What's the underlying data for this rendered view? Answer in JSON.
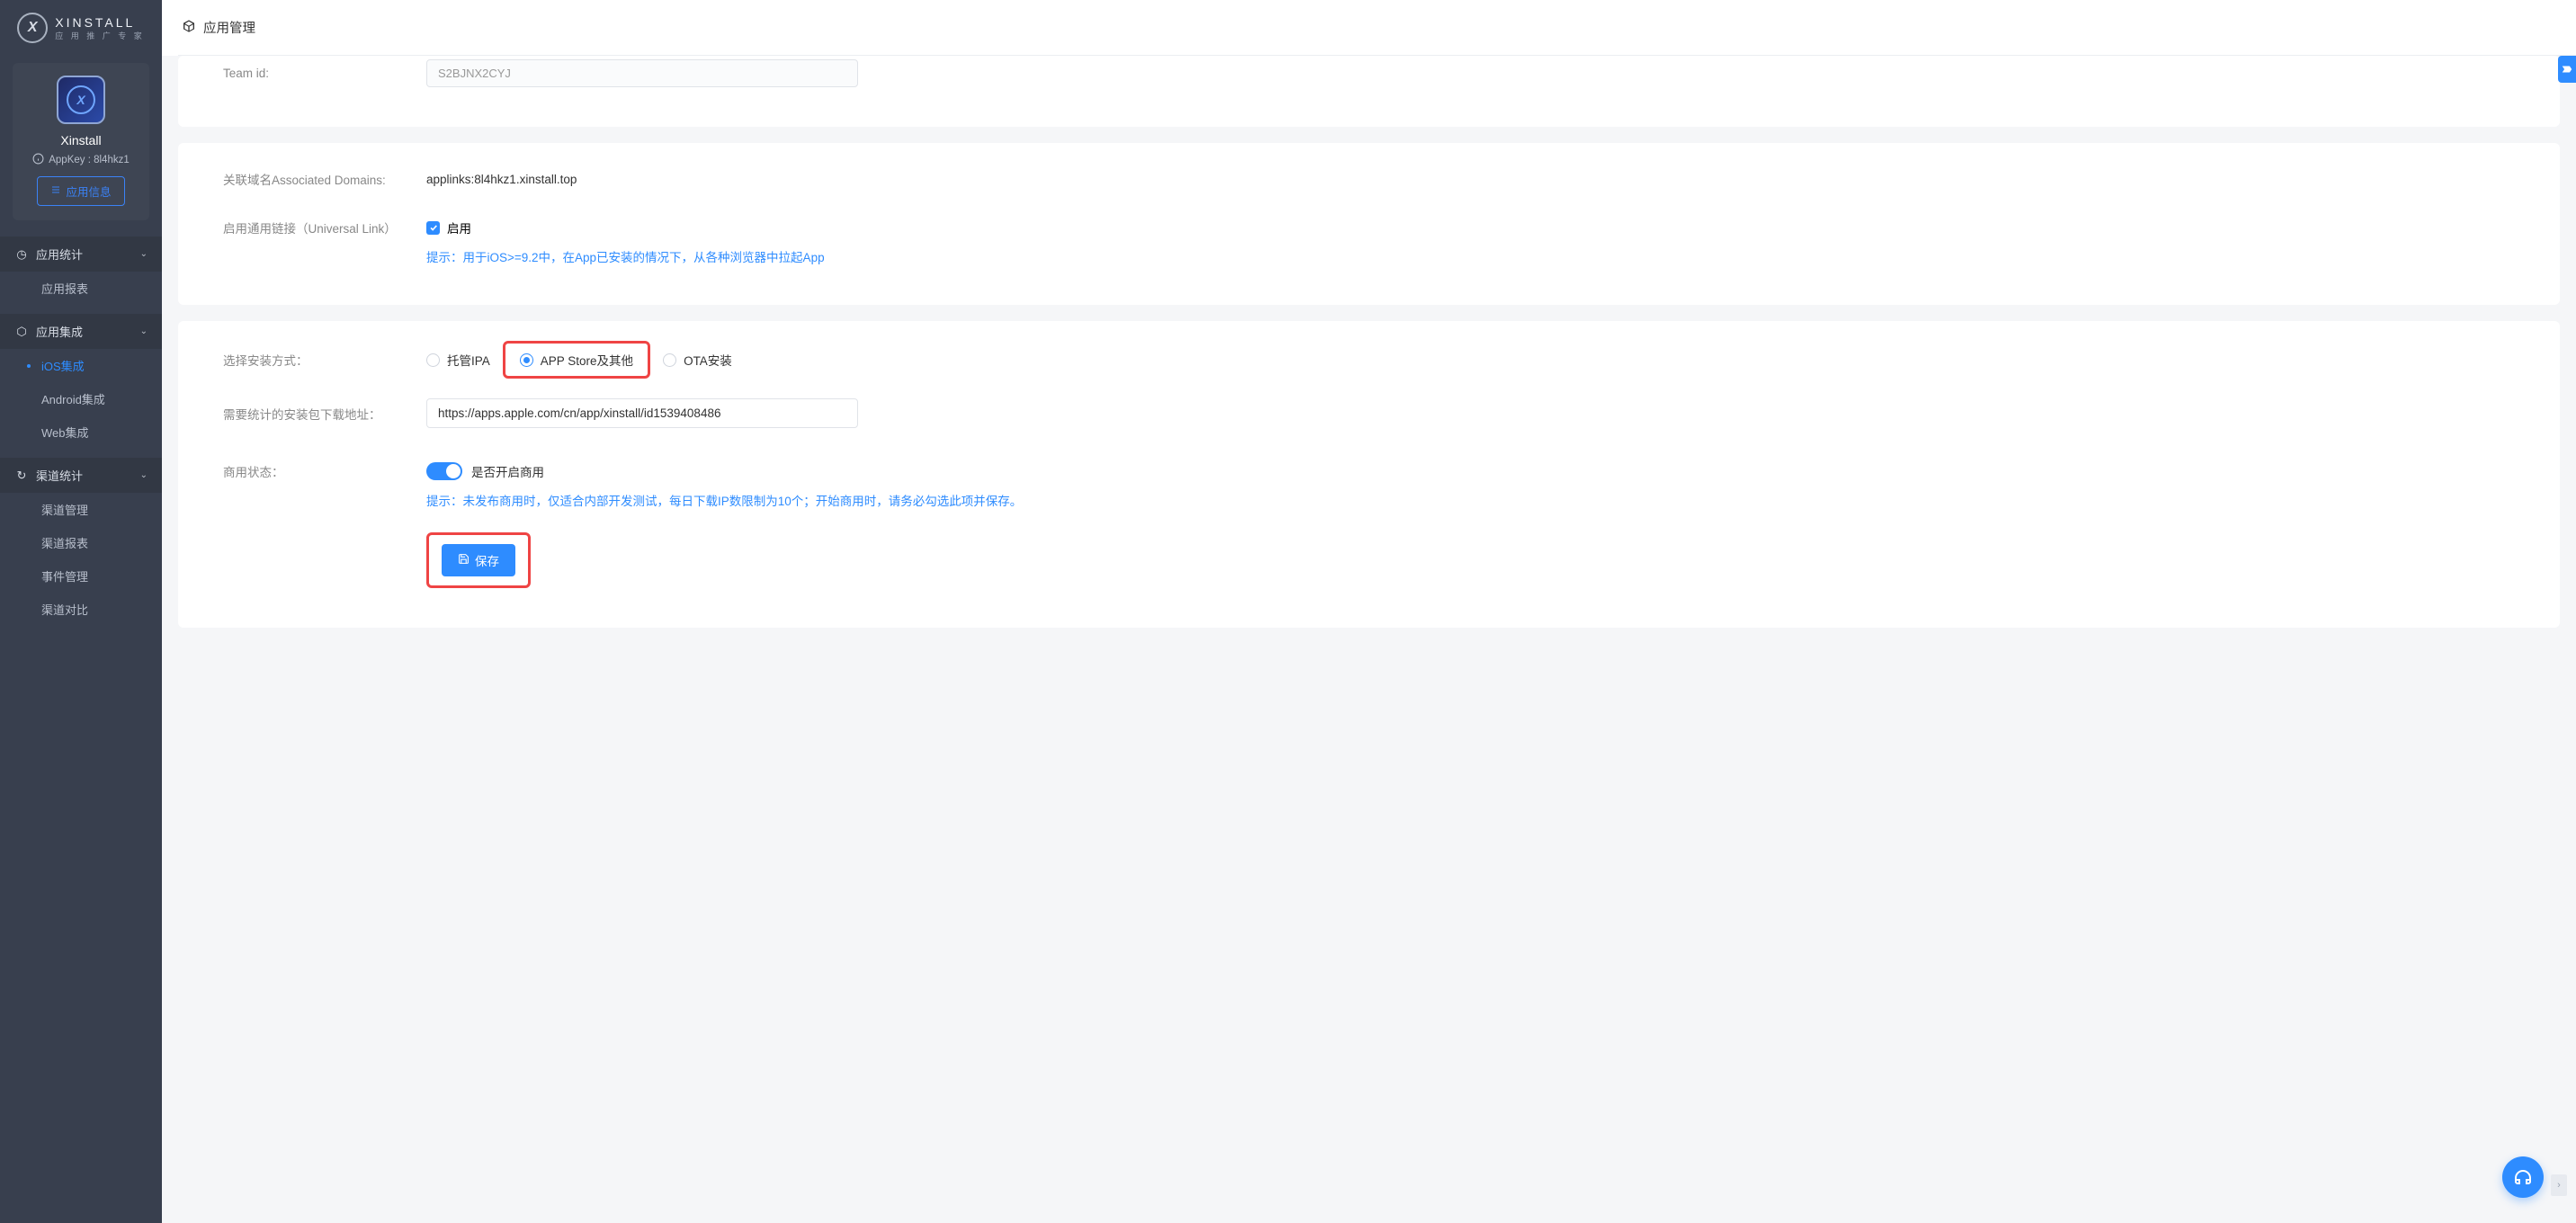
{
  "brand": {
    "title": "XINSTALL",
    "subtitle": "应 用 推 广 专 家"
  },
  "app": {
    "name": "Xinstall",
    "appkey_label": "AppKey : 8l4hkz1",
    "info_btn": "应用信息"
  },
  "topbar": {
    "title": "应用管理"
  },
  "nav": {
    "group1": {
      "title": "应用统计",
      "items": {
        "0": "应用报表"
      }
    },
    "group2": {
      "title": "应用集成",
      "items": {
        "0": "iOS集成",
        "1": "Android集成",
        "2": "Web集成"
      }
    },
    "group3": {
      "title": "渠道统计",
      "items": {
        "0": "渠道管理",
        "1": "渠道报表",
        "2": "事件管理",
        "3": "渠道对比"
      }
    }
  },
  "card1": {
    "teamid_label": "Team id:",
    "teamid_value": "S2BJNX2CYJ"
  },
  "card2": {
    "assoc_label": "关联域名Associated Domains:",
    "assoc_value": "applinks:8l4hkz1.xinstall.top",
    "ul_label": "启用通用链接（Universal Link）",
    "ul_enable": "启用",
    "ul_hint": "提示：用于iOS>=9.2中，在App已安装的情况下，从各种浏览器中拉起App"
  },
  "card3": {
    "install_label": "选择安装方式：",
    "radio1": "托管IPA",
    "radio2": "APP Store及其他",
    "radio3": "OTA安装",
    "url_label": "需要统计的安装包下载地址：",
    "url_value": "https://apps.apple.com/cn/app/xinstall/id1539408486",
    "commercial_label": "商用状态：",
    "commercial_switch": "是否开启商用",
    "commercial_hint": "提示：未发布商用时，仅适合内部开发测试，每日下载IP数限制为10个；开始商用时，请务必勾选此项并保存。",
    "save": "保存"
  }
}
